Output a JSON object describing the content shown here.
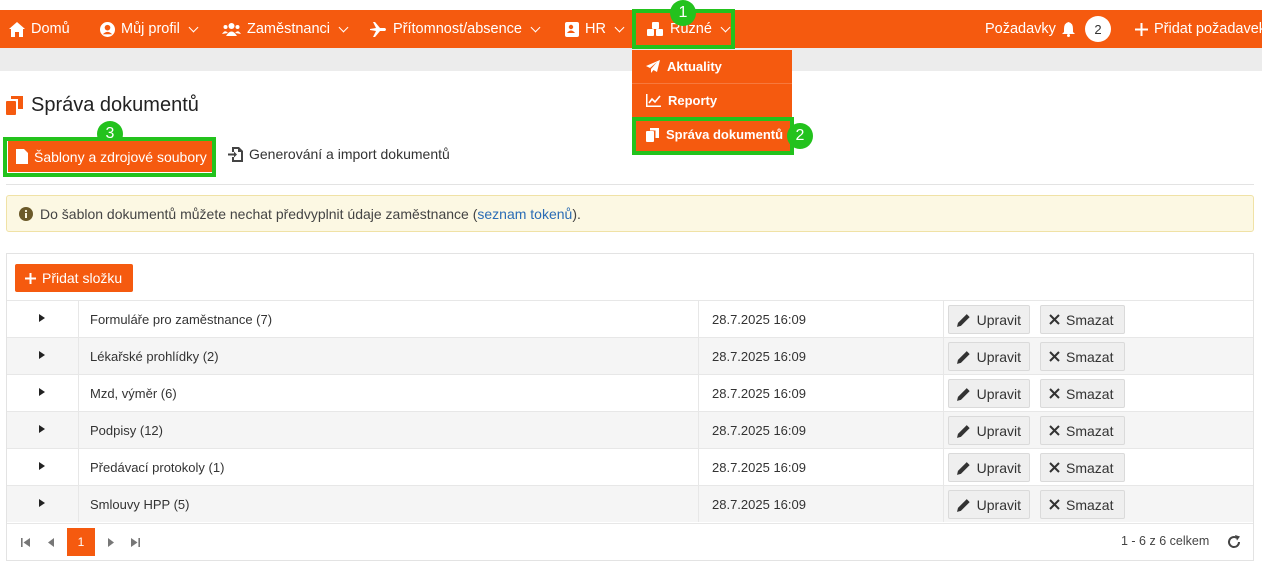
{
  "nav": {
    "home": "Domů",
    "profile": "Můj profil",
    "employees": "Zaměstnanci",
    "attendance": "Přítomnost/absence",
    "hr": "HR",
    "misc": "Různé",
    "requests": "Požadavky",
    "requests_count": "2",
    "add_request": "Přidat požadavek"
  },
  "dropdown": {
    "items": [
      "Aktuality",
      "Reporty",
      "Správa dokumentů"
    ]
  },
  "annotations": [
    "1",
    "2",
    "3"
  ],
  "page": {
    "title": "Správa dokumentů"
  },
  "tabs": {
    "active": "Šablony a zdrojové soubory",
    "second": "Generování a import dokumentů"
  },
  "alert": {
    "text": "Do šablon dokumentů můžete nechat předvyplnit údaje zaměstnance (",
    "link": "seznam tokenů",
    "suffix": ")."
  },
  "add_folder": "Přidat složku",
  "folders": [
    {
      "name": "Formuláře pro zaměstnance (7)",
      "date": "28.7.2025 16:09"
    },
    {
      "name": "Lékařské prohlídky (2)",
      "date": "28.7.2025 16:09"
    },
    {
      "name": "Mzd, výměr (6)",
      "date": "28.7.2025 16:09"
    },
    {
      "name": "Podpisy (12)",
      "date": "28.7.2025 16:09"
    },
    {
      "name": "Předávací protokoly (1)",
      "date": "28.7.2025 16:09"
    },
    {
      "name": "Smlouvy HPP (5)",
      "date": "28.7.2025 16:09"
    }
  ],
  "row_actions": {
    "edit": "Upravit",
    "delete": "Smazat"
  },
  "pager": {
    "current": "1",
    "summary": "1 - 6 z 6 celkem"
  },
  "colors": {
    "brand": "#f55a0f",
    "annotation": "#23c21d"
  }
}
